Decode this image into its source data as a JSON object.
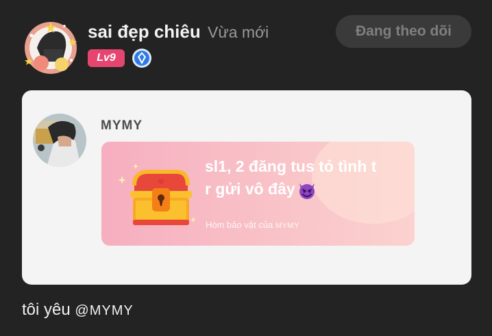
{
  "post": {
    "author": {
      "name": "sai đẹp chiêu",
      "time": "Vừa mới",
      "level": "Lv9",
      "follow_label": "Đang theo dõi"
    },
    "shared_card": {
      "owner": "MYMY",
      "treasure": {
        "line1": "sl1, 2 đăng tus tỏ tình t",
        "line2": "r gửi vô đây",
        "emoji": "smiling-devil-emoji",
        "caption_prefix": "Hòm bảo vật của",
        "caption_owner": "MYMY"
      }
    },
    "caption": {
      "text": "tôi yêu ",
      "mention": "@MYMY"
    }
  },
  "colors": {
    "background": "#232323",
    "level_badge": "#e5456f",
    "verify_badge": "#2f7be6",
    "card": "#f4f4f4",
    "treasure_gradient_start": "#f6aec0",
    "treasure_gradient_end": "#fbd2cf",
    "follow_button": "#3a3a3a"
  }
}
